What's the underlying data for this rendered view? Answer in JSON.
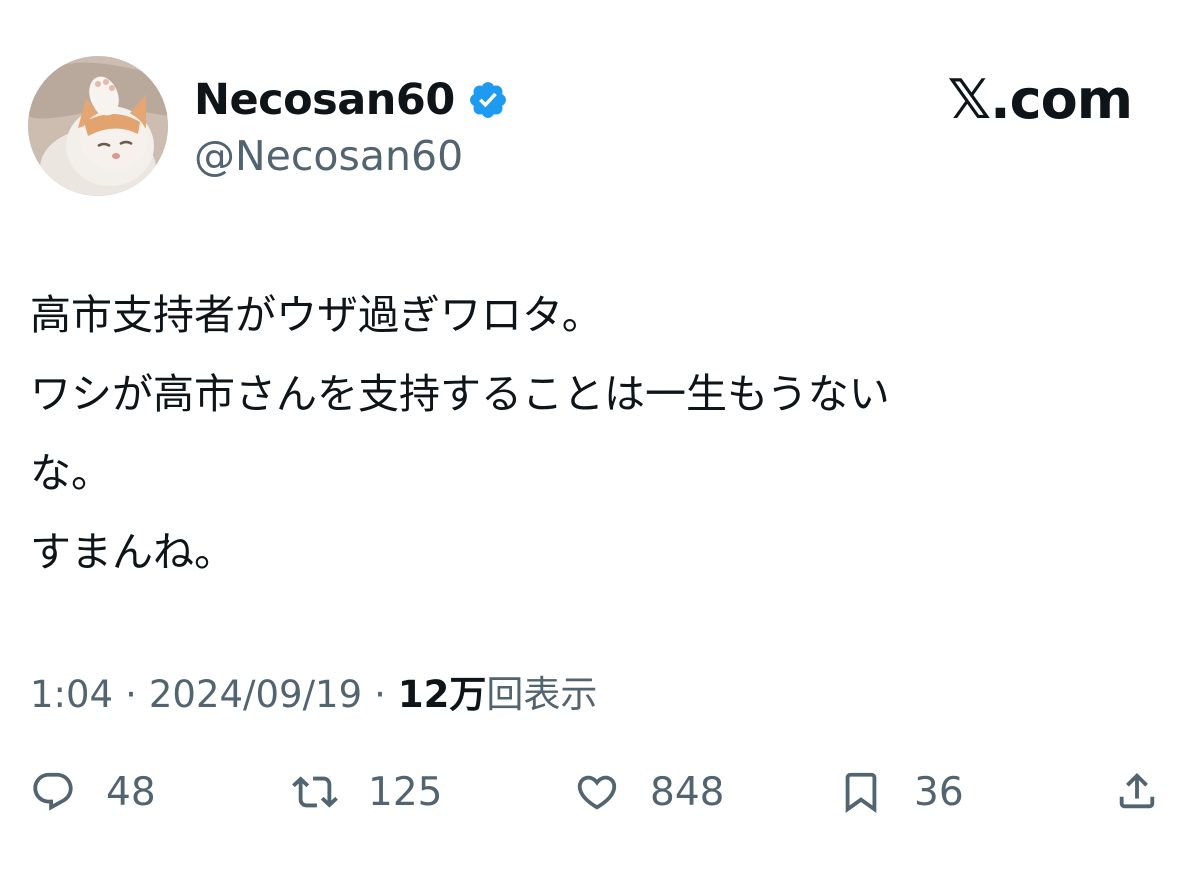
{
  "author": {
    "display_name": "Necosan60",
    "handle": "@Necosan60",
    "verified": true
  },
  "brand": "𝕏.com",
  "tweet": {
    "lines": [
      "高市支持者がウザ過ぎワロタ。",
      "ワシが高市さんを支持することは一生もうない",
      "な。",
      "すまんね。"
    ]
  },
  "meta": {
    "time": "1:04",
    "date": "2024/09/19",
    "separator": "·",
    "views_count": "12万",
    "views_label": "回表示"
  },
  "actions": {
    "replies": "48",
    "reposts": "125",
    "likes": "848",
    "bookmarks": "36"
  },
  "colors": {
    "text": "#0f1419",
    "secondary": "#536471",
    "verified": "#1d9bf0"
  }
}
